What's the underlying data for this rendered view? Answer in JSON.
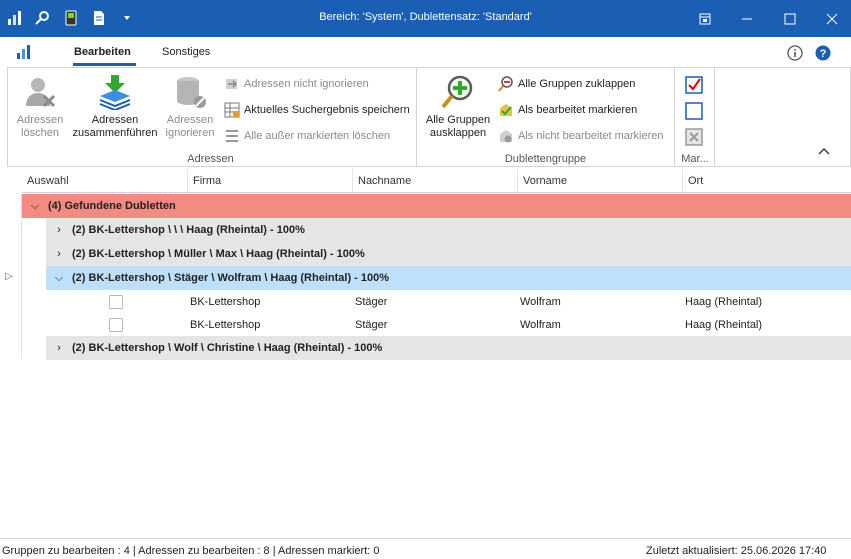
{
  "window": {
    "title": "Bereich: 'System', Dublettensatz: 'Standard'"
  },
  "quick_access": [
    "chart-icon",
    "search-user-icon",
    "phone-icon",
    "document-icon",
    "dropdown-arrow-icon"
  ],
  "tabs": [
    {
      "label": "Bearbeiten",
      "active": true
    },
    {
      "label": "Sonstiges",
      "active": false
    }
  ],
  "ribbon": {
    "adressen": {
      "group_label": "Adressen",
      "loeschen": {
        "line1": "Adressen",
        "line2": "löschen"
      },
      "zusammenfuehren": {
        "line1": "Adressen",
        "line2": "zusammenführen"
      },
      "ignorieren": {
        "line1": "Adressen",
        "line2": "ignorieren"
      },
      "nicht_ignorieren": "Adressen nicht ignorieren",
      "suchergebnis": "Aktuelles Suchergebnis speichern",
      "alle_ausser": "Alle außer markierten  löschen"
    },
    "dublettengruppe": {
      "group_label": "Dublettengruppe",
      "ausklappen": {
        "line1": "Alle Gruppen",
        "line2": "ausklappen"
      },
      "zuklappen": "Alle Gruppen zuklappen",
      "bearbeitet": "Als bearbeitet markieren",
      "nicht_bearbeitet": "Als nicht bearbeitet markieren"
    },
    "markieren": {
      "group_label": "Mar..."
    }
  },
  "grid": {
    "columns": [
      "Auswahl",
      "Firma",
      "Nachname",
      "Vorname",
      "Ort"
    ],
    "top_group": "(4) Gefundene Dubletten",
    "groups": [
      "(2) BK-Lettershop \\  \\  \\ Haag (Rheintal) - 100%",
      "(2) BK-Lettershop \\ Müller \\ Max \\ Haag (Rheintal) - 100%",
      "(2) BK-Lettershop \\ Stäger \\ Wolfram \\ Haag (Rheintal) - 100%",
      "(2) BK-Lettershop \\ Wolf \\ Christine \\ Haag (Rheintal) - 100%"
    ],
    "rows": [
      {
        "firma": "BK-Lettershop",
        "nachname": "Stäger",
        "vorname": "Wolfram",
        "ort": "Haag (Rheintal)"
      },
      {
        "firma": "BK-Lettershop",
        "nachname": "Stäger",
        "vorname": "Wolfram",
        "ort": "Haag (Rheintal)"
      }
    ]
  },
  "status": {
    "left": "Gruppen zu bearbeiten : 4 | Adressen zu bearbeiten : 8 | Adressen markiert: 0",
    "right": "Zuletzt aktualisiert: 25.06.2026 17:40"
  },
  "colors": {
    "titlebar": "#1a5fb4",
    "top_group": "#f28b82",
    "selected_group": "#bfe0fb",
    "group": "#e5e5e5"
  }
}
